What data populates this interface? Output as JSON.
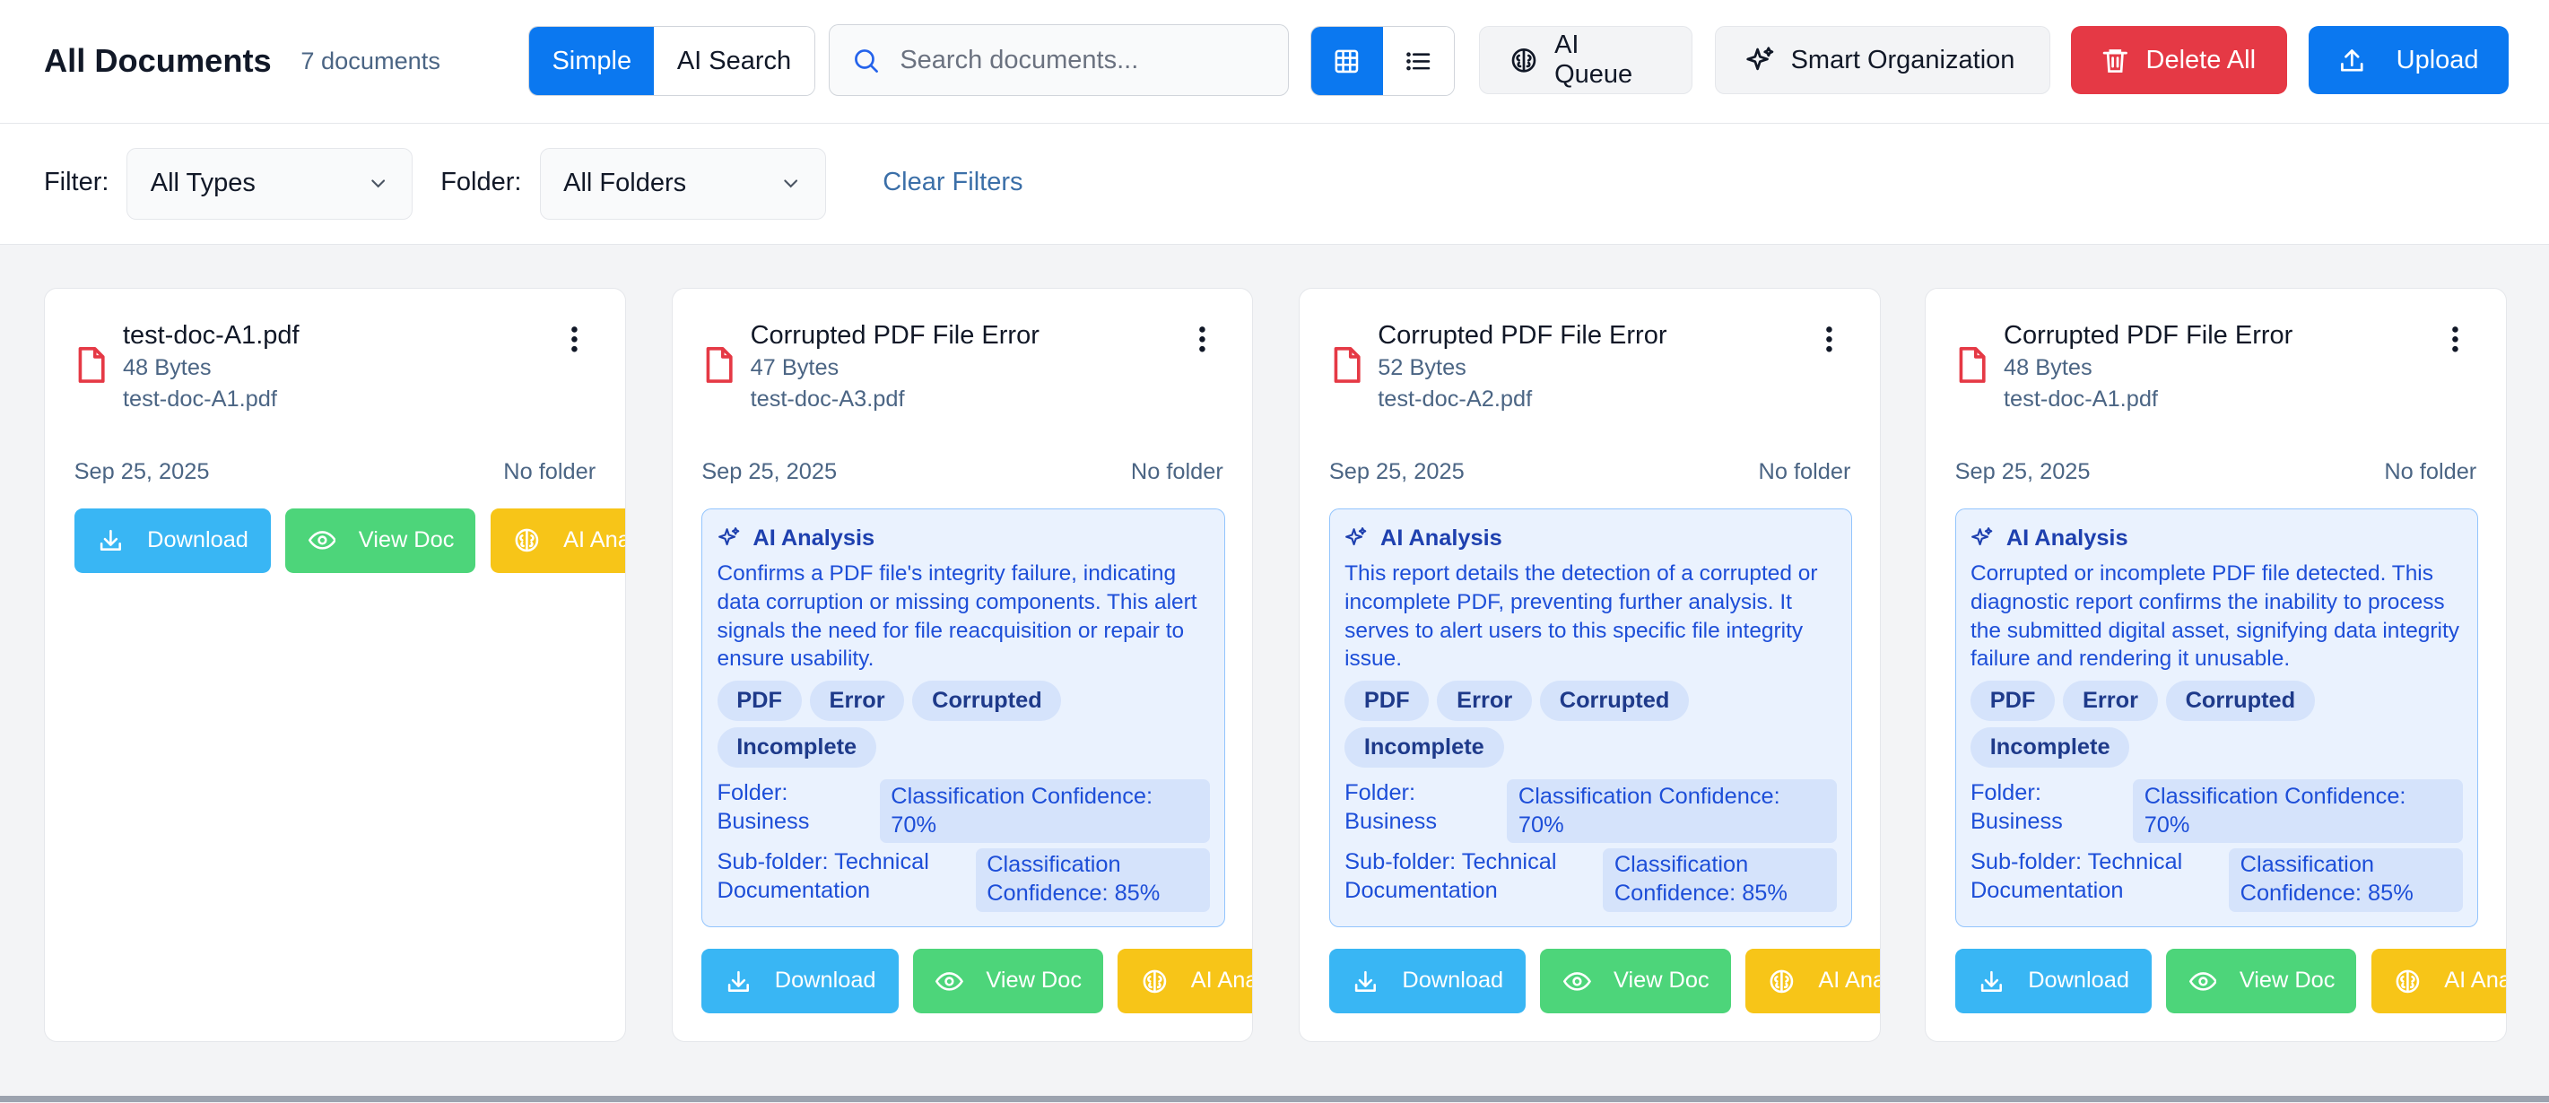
{
  "header": {
    "title": "All Documents",
    "count": "7 documents",
    "search_modes": [
      "Simple",
      "AI Search"
    ],
    "active_search_mode": "Simple",
    "search_placeholder": "Search documents...",
    "view_modes": [
      "grid-icon",
      "list-icon"
    ],
    "active_view": "grid",
    "ai_queue_label": "AI Queue",
    "smart_org_label": "Smart Organization",
    "delete_all_label": "Delete All",
    "upload_label": "Upload"
  },
  "filters": {
    "filter_label": "Filter:",
    "filter_value": "All Types",
    "folder_label": "Folder:",
    "folder_value": "All Folders",
    "clear_label": "Clear Filters"
  },
  "colors": {
    "primary": "#0b78f0",
    "danger": "#e53945",
    "download": "#39b6f4",
    "view": "#4dd57a",
    "analyze": "#f7c518"
  },
  "actions": {
    "download": "Download",
    "view": "View Doc",
    "analyze": "AI Analyze"
  },
  "cards": [
    {
      "name": "test-doc-A1.pdf",
      "size": "48 Bytes",
      "file": "test-doc-A1.pdf",
      "date": "Sep 25, 2025",
      "folder": "No folder"
    },
    {
      "name": "Corrupted PDF File Error",
      "size": "47 Bytes",
      "file": "test-doc-A3.pdf",
      "date": "Sep 25, 2025",
      "folder": "No folder",
      "analysis": {
        "heading": "AI Analysis",
        "description": "Confirms a PDF file's integrity failure, indicating data corruption or missing components. This alert signals the need for file reacquisition or repair to ensure usability.",
        "tags": [
          "PDF",
          "Error",
          "Corrupted",
          "Incomplete"
        ],
        "folder": "Folder: Business",
        "folder_confidence": "Classification Confidence: 70%",
        "subfolder": "Sub-folder: Technical Documentation",
        "subfolder_confidence": "Classification Confidence: 85%"
      }
    },
    {
      "name": "Corrupted PDF File Error",
      "size": "52 Bytes",
      "file": "test-doc-A2.pdf",
      "date": "Sep 25, 2025",
      "folder": "No folder",
      "analysis": {
        "heading": "AI Analysis",
        "description": "This report details the detection of a corrupted or incomplete PDF, preventing further analysis. It serves to alert users to this specific file integrity issue.",
        "tags": [
          "PDF",
          "Error",
          "Corrupted",
          "Incomplete"
        ],
        "folder": "Folder: Business",
        "folder_confidence": "Classification Confidence: 70%",
        "subfolder": "Sub-folder: Technical Documentation",
        "subfolder_confidence": "Classification Confidence: 85%"
      }
    },
    {
      "name": "Corrupted PDF File Error",
      "size": "48 Bytes",
      "file": "test-doc-A1.pdf",
      "date": "Sep 25, 2025",
      "folder": "No folder",
      "analysis": {
        "heading": "AI Analysis",
        "description": "Corrupted or incomplete PDF file detected. This diagnostic report confirms the inability to process the submitted digital asset, signifying data integrity failure and rendering it unusable.",
        "tags": [
          "PDF",
          "Error",
          "Corrupted",
          "Incomplete"
        ],
        "folder": "Folder: Business",
        "folder_confidence": "Classification Confidence: 70%",
        "subfolder": "Sub-folder: Technical Documentation",
        "subfolder_confidence": "Classification Confidence: 85%"
      }
    }
  ]
}
